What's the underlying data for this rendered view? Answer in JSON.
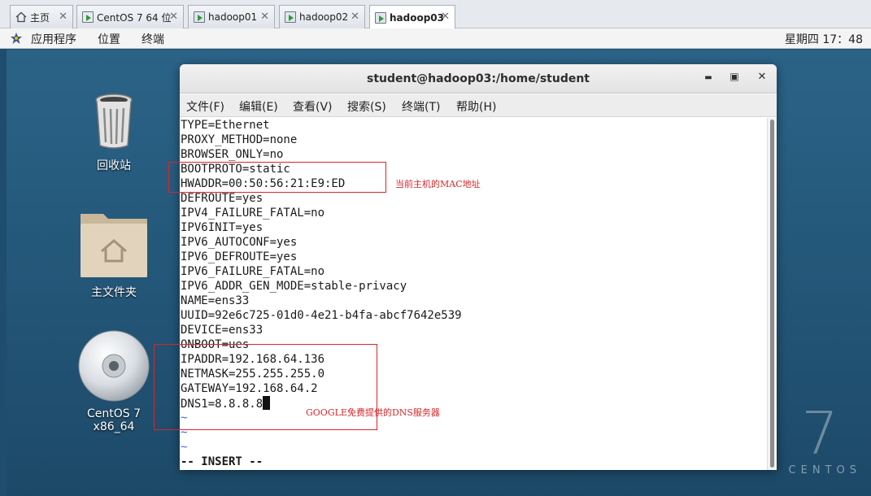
{
  "tabs": [
    {
      "label": "主页",
      "icon": "home-icon"
    },
    {
      "label": "CentOS 7 64 位",
      "icon": "vm-icon"
    },
    {
      "label": "hadoop01",
      "icon": "vm-running-icon"
    },
    {
      "label": "hadoop02",
      "icon": "vm-running-icon"
    },
    {
      "label": "hadoop03",
      "icon": "vm-running-icon",
      "active": true
    }
  ],
  "tab_close_glyph": "✕",
  "topbar": {
    "menus": [
      "应用程序",
      "位置",
      "终端"
    ],
    "clock": "星期四 17：48"
  },
  "desktop": {
    "icons": [
      {
        "label": "回收站",
        "icon": "trash-icon"
      },
      {
        "label": "主文件夹",
        "icon": "home-folder-icon"
      },
      {
        "label": "CentOS 7 x86_64",
        "icon": "disc-icon"
      }
    ],
    "watermark_number": "7",
    "watermark_word": "CENTOS"
  },
  "terminal": {
    "title": "student@hadoop03:/home/student",
    "buttons": {
      "minimize": "▬",
      "maximize": "▣",
      "close": "✕"
    },
    "menu": [
      "文件(F)",
      "编辑(E)",
      "查看(V)",
      "搜索(S)",
      "终端(T)",
      "帮助(H)"
    ],
    "lines": [
      "TYPE=Ethernet",
      "PROXY_METHOD=none",
      "BROWSER_ONLY=no",
      "BOOTPROTO=static",
      "HWADDR=00:50:56:21:E9:ED",
      "DEFROUTE=yes",
      "IPV4_FAILURE_FATAL=no",
      "IPV6INIT=yes",
      "IPV6_AUTOCONF=yes",
      "IPV6_DEFROUTE=yes",
      "IPV6_FAILURE_FATAL=no",
      "IPV6_ADDR_GEN_MODE=stable-privacy",
      "NAME=ens33",
      "UUID=92e6c725-01d0-4e21-b4fa-abcf7642e539",
      "DEVICE=ens33",
      "ONBOOT=ues",
      "IPADDR=192.168.64.136",
      "NETMASK=255.255.255.0",
      "GATEWAY=192.168.64.2",
      "DNS1=8.8.8.8"
    ],
    "tilde_lines": [
      "~",
      "~",
      "~"
    ],
    "status_line": "-- INSERT --"
  },
  "annotations": {
    "mac_note": "当前主机的MAC地址",
    "dns_note": "GOOGLE免费提供的DNS服务器",
    "color": "#d9262a"
  }
}
